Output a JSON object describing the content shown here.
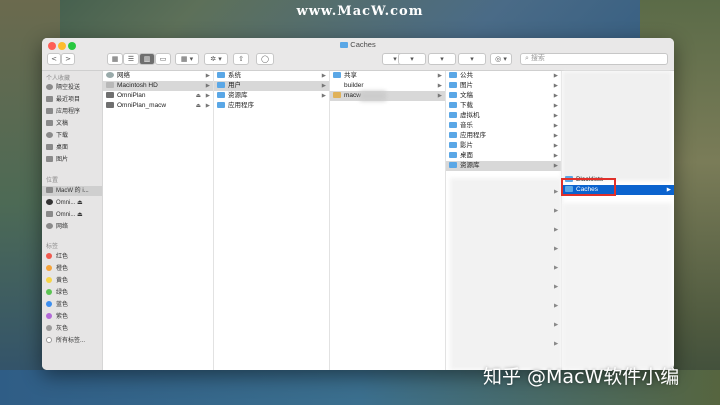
{
  "watermark_top": "www.MacW.com",
  "watermark_bottom": "知乎 @MacW软件小编",
  "window": {
    "title": "Caches"
  },
  "toolbar": {
    "back": "<",
    "forward": ">",
    "search_placeholder": "搜索"
  },
  "sidebar": {
    "favorites_header": "个人收藏",
    "favorites": [
      "隔空投送",
      "最近项目",
      "应用程序",
      "文稿",
      "下载",
      "桌面",
      "图片"
    ],
    "locations_header": "位置",
    "locations": [
      "MacW 的 i...",
      "Omni...",
      "Omni...",
      "网络"
    ],
    "tags_header": "标签",
    "tags": [
      {
        "label": "红色",
        "color": "#f05a4f"
      },
      {
        "label": "橙色",
        "color": "#f6a43a"
      },
      {
        "label": "黄色",
        "color": "#f7d547"
      },
      {
        "label": "绿色",
        "color": "#5bc454"
      },
      {
        "label": "蓝色",
        "color": "#3c8ff0"
      },
      {
        "label": "紫色",
        "color": "#b36ad8"
      },
      {
        "label": "灰色",
        "color": "#9b9b9b"
      },
      {
        "label": "所有标签...",
        "color": "#ffffff"
      }
    ]
  },
  "columns": {
    "col1": [
      "网络",
      "Macintosh HD",
      "OmniPlan",
      "OmniPlan_macw"
    ],
    "col2": [
      "系统",
      "用户",
      "资源库",
      "应用程序"
    ],
    "col3": [
      "共享",
      "builder",
      "macw"
    ],
    "col4": [
      "公共",
      "图片",
      "文稿",
      "下载",
      "虚拟机",
      "音乐",
      "应用程序",
      "影片",
      "桌面",
      "资源库"
    ],
    "col5": [
      "Blacklists",
      "Caches"
    ]
  },
  "colors": {
    "selection": "#0b63ce",
    "highlight_box": "#e0302a",
    "folder": "#5aa7e6"
  }
}
